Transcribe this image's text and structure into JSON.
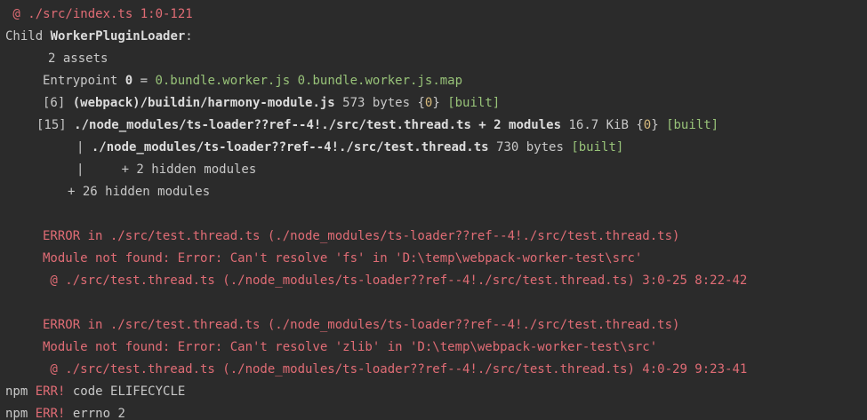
{
  "lines": [
    {
      "kind": "at",
      "text": " @ ./src/index.ts 1:0-121"
    },
    {
      "kind": "child",
      "prefix": "Child ",
      "name": "WorkerPluginLoader",
      "suffix": ":"
    },
    {
      "kind": "assets",
      "text": "2 assets"
    },
    {
      "kind": "entry",
      "label": "Entrypoint ",
      "zero": "0",
      "eq": " = ",
      "files": "0.bundle.worker.js 0.bundle.worker.js.map"
    },
    {
      "kind": "mod1",
      "id": "[6] ",
      "path": "(webpack)/buildin/harmony-module.js",
      "size": " 573 bytes ",
      "chunk_open": "{",
      "chunk": "0",
      "chunk_close": "}",
      "built": " [built]"
    },
    {
      "kind": "mod2",
      "id": "[15] ",
      "path": "./node_modules/ts-loader??ref--4!./src/test.thread.ts + 2 modules",
      "size": " 16.7 KiB ",
      "chunk_open": "{",
      "chunk": "0",
      "chunk_close": "}",
      "built": " [built]"
    },
    {
      "kind": "sub1",
      "pipe": "| ",
      "path": "./node_modules/ts-loader??ref--4!./src/test.thread.ts",
      "size": " 730 bytes ",
      "built": "[built]"
    },
    {
      "kind": "sub2",
      "text": "|     + 2 hidden modules"
    },
    {
      "kind": "hidden",
      "text": "+ 26 hidden modules"
    },
    {
      "kind": "blank"
    },
    {
      "kind": "err",
      "text": "ERROR in ./src/test.thread.ts (./node_modules/ts-loader??ref--4!./src/test.thread.ts)"
    },
    {
      "kind": "err",
      "text": "Module not found: Error: Can't resolve 'fs' in 'D:\\temp\\webpack-worker-test\\src'"
    },
    {
      "kind": "err2",
      "text": " @ ./src/test.thread.ts (./node_modules/ts-loader??ref--4!./src/test.thread.ts) 3:0-25 8:22-42"
    },
    {
      "kind": "blank"
    },
    {
      "kind": "err",
      "text": "ERROR in ./src/test.thread.ts (./node_modules/ts-loader??ref--4!./src/test.thread.ts)"
    },
    {
      "kind": "err",
      "text": "Module not found: Error: Can't resolve 'zlib' in 'D:\\temp\\webpack-worker-test\\src'"
    },
    {
      "kind": "err2",
      "text": " @ ./src/test.thread.ts (./node_modules/ts-loader??ref--4!./src/test.thread.ts) 4:0-29 9:23-41"
    },
    {
      "kind": "npm",
      "npm": "npm ",
      "err": "ERR!",
      "rest": " code ELIFECYCLE"
    },
    {
      "kind": "npm",
      "npm": "npm ",
      "err": "ERR!",
      "rest": " errno 2"
    }
  ]
}
